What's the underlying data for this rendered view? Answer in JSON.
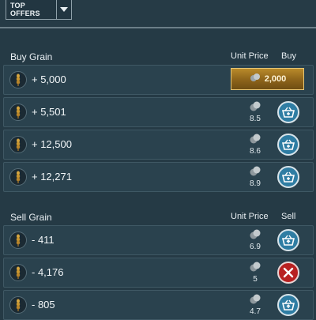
{
  "header": {
    "offers_label": "TOP OFFERS"
  },
  "buy": {
    "title": "Buy Grain",
    "col_price": "Unit Price",
    "col_action": "Buy",
    "first_offer": {
      "qty": "+ 5,000",
      "button_value": "2,000"
    },
    "rows": [
      {
        "qty": "+ 5,501",
        "price": "8.5"
      },
      {
        "qty": "+ 12,500",
        "price": "8.6"
      },
      {
        "qty": "+ 12,271",
        "price": "8.9"
      }
    ]
  },
  "sell": {
    "title": "Sell Grain",
    "col_price": "Unit Price",
    "col_action": "Sell",
    "rows": [
      {
        "qty": "- 411",
        "price": "6.9",
        "action": "sell"
      },
      {
        "qty": "- 4,176",
        "price": "5",
        "action": "reject"
      },
      {
        "qty": "- 805",
        "price": "4.7",
        "action": "sell"
      }
    ]
  },
  "colors": {
    "background": "#253a45",
    "row": "#2a424e",
    "action": "#2f7da3",
    "reject": "#b82121",
    "gold": "#b98a2a"
  },
  "icons": {
    "grain": "grain-icon",
    "coins": "coins-icon",
    "basket": "basket-icon",
    "close": "close-icon",
    "dropdown": "caret-down-icon"
  }
}
